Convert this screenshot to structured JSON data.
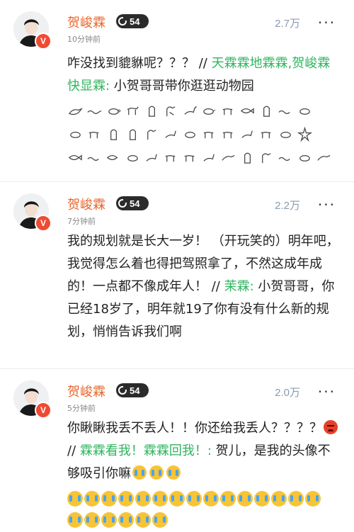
{
  "posts": [
    {
      "username": "贺峻霖",
      "level": "54",
      "time": "10分钟前",
      "likes": "2.7万",
      "more": "···",
      "badge": "V",
      "text_a": "咋没找到貔貅呢？？？ // ",
      "mention": "天霖霖地霖霖,贺峻霖快显霖:",
      "text_b": " 小贺哥哥带你逛逛动物园",
      "glyph_icons": [
        "hieroglyph-bird-icon",
        "hieroglyph-snake-icon",
        "hieroglyph-turtle-icon",
        "hieroglyph-bull-icon",
        "hieroglyph-owl-icon",
        "hieroglyph-rabbit-icon",
        "hieroglyph-fish-icon",
        "hieroglyph-star-icon"
      ]
    },
    {
      "username": "贺峻霖",
      "level": "54",
      "time": "7分钟前",
      "likes": "2.2万",
      "more": "···",
      "badge": "V",
      "text_a": "我的规划就是长大一岁！ （开玩笑的）明年吧，我觉得怎么着也得把驾照拿了，不然这成年成的！一点都不像成年人！ // ",
      "mention": "茉霖:",
      "text_b": " 小贺哥哥，你已经18岁了，明年就19了你有没有什么新的规划，悄悄告诉我们啊"
    },
    {
      "username": "贺峻霖",
      "level": "54",
      "time": "5分钟前",
      "likes": "2.0万",
      "more": "···",
      "badge": "V",
      "text_a": "你瞅瞅我丢不丢人！！你还给我丢人？？？？",
      "text_sep": " // ",
      "mention": "霖霖看我！霖霖回我！:",
      "text_b": " 贺儿，是我的头像不够吸引你嘛"
    }
  ],
  "emoji": {
    "angry": "angry-face-icon",
    "cry": "crying-face-icon"
  }
}
